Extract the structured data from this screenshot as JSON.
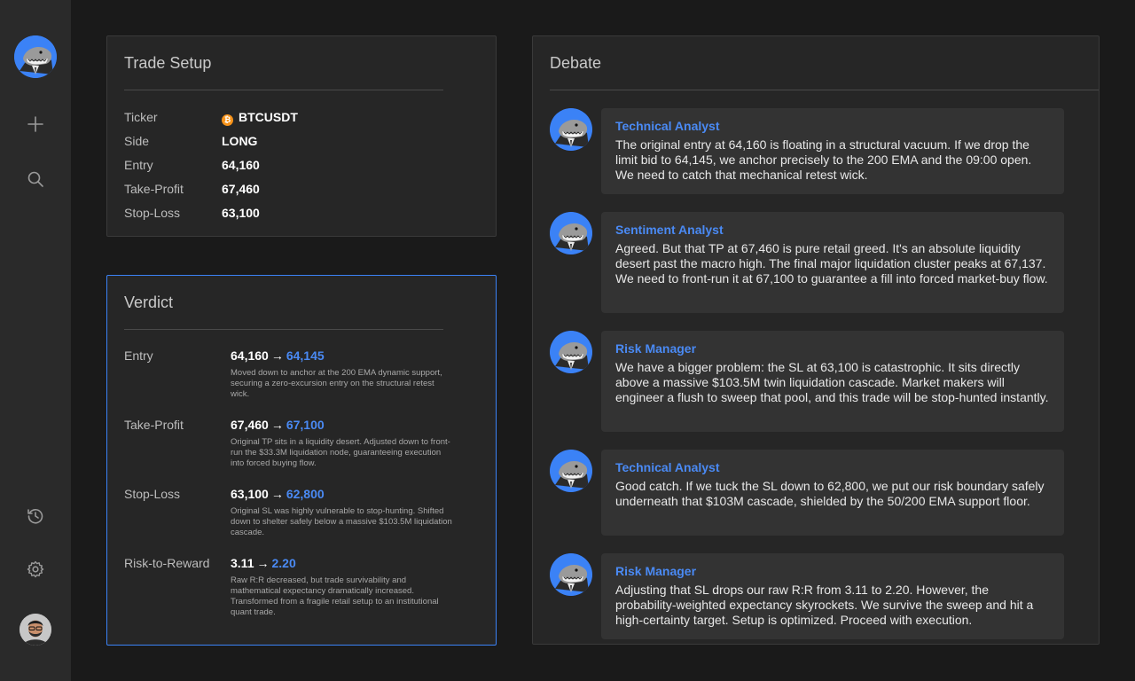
{
  "sidebar": {
    "items": [
      {
        "name": "new",
        "icon": "plus-icon"
      },
      {
        "name": "search",
        "icon": "search-icon"
      },
      {
        "name": "history",
        "icon": "history-icon"
      },
      {
        "name": "settings",
        "icon": "gear-icon"
      }
    ]
  },
  "setup": {
    "title": "Trade Setup",
    "rows": [
      {
        "label": "Ticker",
        "value": "BTCUSDT"
      },
      {
        "label": "Side",
        "value": "LONG"
      },
      {
        "label": "Entry",
        "value": "64,160"
      },
      {
        "label": "Take-Profit",
        "value": "67,460"
      },
      {
        "label": "Stop-Loss",
        "value": "63,100"
      }
    ],
    "ticker_coin_glyph": "₿"
  },
  "verdict": {
    "title": "Verdict",
    "arrow": "→",
    "rows": [
      {
        "label": "Entry",
        "old": "64,160",
        "new": "64,145",
        "note": "Moved down to anchor at the 200 EMA dynamic support, securing a zero-excursion entry on the structural retest wick."
      },
      {
        "label": "Take-Profit",
        "old": "67,460",
        "new": "67,100",
        "note": "Original TP sits in a liquidity desert. Adjusted down to front-run the $33.3M liquidation node, guaranteeing execution into forced buying flow."
      },
      {
        "label": "Stop-Loss",
        "old": "63,100",
        "new": "62,800",
        "note": "Original SL was highly vulnerable to stop-hunting. Shifted down to shelter safely below a massive $103.5M liquidation cascade."
      },
      {
        "label": "Risk-to-Reward",
        "old": "3.11",
        "new": "2.20",
        "note": "Raw R:R decreased, but trade survivability and mathematical expectancy dramatically increased. Transformed from a fragile retail setup to an institutional quant trade."
      }
    ]
  },
  "debate": {
    "title": "Debate",
    "messages": [
      {
        "speaker": "Technical Analyst",
        "text": "The original entry at 64,160 is floating in a structural vacuum. If we drop the limit bid to 64,145, we anchor precisely to the 200 EMA and the 09:00 open. We need to catch that mechanical retest wick."
      },
      {
        "speaker": "Sentiment Analyst",
        "text": "Agreed. But that TP at 67,460 is pure retail greed. It's an absolute liquidity desert past the macro high. The final major liquidation cluster peaks at 67,137. We need to front-run it at 67,100 to guarantee a fill into forced market-buy flow."
      },
      {
        "speaker": "Risk Manager",
        "text": "We have a bigger problem: the SL at 63,100 is catastrophic. It sits directly above a massive $103.5M twin liquidation cascade. Market makers will engineer a flush to sweep that pool, and this trade will be stop-hunted instantly."
      },
      {
        "speaker": "Technical Analyst",
        "text": "Good catch. If we tuck the SL down to 62,800, we put our risk boundary safely underneath that $103M cascade, shielded by the 50/200 EMA support floor."
      },
      {
        "speaker": "Risk Manager",
        "text": "Adjusting that SL drops our raw R:R from 3.11 to 2.20. However, the probability-weighted expectancy skyrockets. We survive the sweep and hit a high-certainty target. Setup is optimized. Proceed with execution."
      }
    ]
  },
  "colors": {
    "accent": "#4a8af4",
    "background": "#1a1a1a",
    "sidebar": "#2a2a2a",
    "panel": "#262626",
    "bubble": "#333333",
    "btc": "#f7931a"
  }
}
